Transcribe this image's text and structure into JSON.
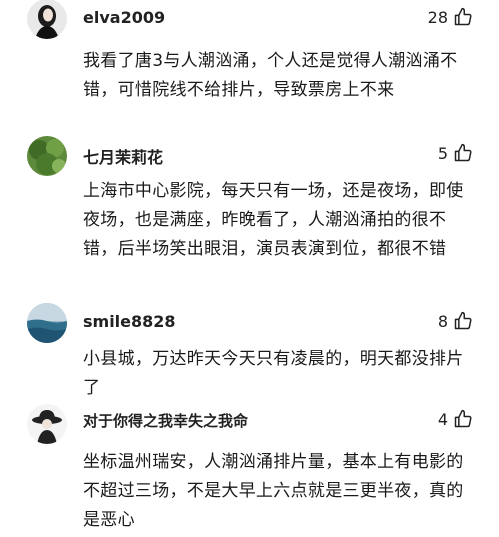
{
  "comments": [
    {
      "username": "elva2009",
      "likes": "28",
      "text": "我看了唐3与人潮汹涌，个人还是觉得人潮汹涌不错，可惜院线不给排片，导致票房上不来",
      "avatar": "avatar-woman-dark-hair"
    },
    {
      "username": "七月茉莉花",
      "likes": "5",
      "text": "上海市中心影院，每天只有一场，还是夜场，即使夜场，也是满座，昨晚看了，人潮汹涌拍的很不错，后半场笑出眼泪，演员表演到位，都很不错",
      "avatar": "avatar-green-foliage"
    },
    {
      "username": "smile8828",
      "likes": "8",
      "text": "小县城，万达昨天今天只有凌晨的，明天都没排片了",
      "avatar": "avatar-sea-landscape"
    },
    {
      "username": "对于你得之我幸失之我命",
      "likes": "4",
      "text": "坐标温州瑞安，人潮汹涌排片量，基本上有电影的不超过三场，不是大早上六点就是三更半夜，真的是恶心",
      "avatar": "avatar-hat-figure"
    }
  ],
  "icons": {
    "like": "thumbs-up-icon"
  }
}
